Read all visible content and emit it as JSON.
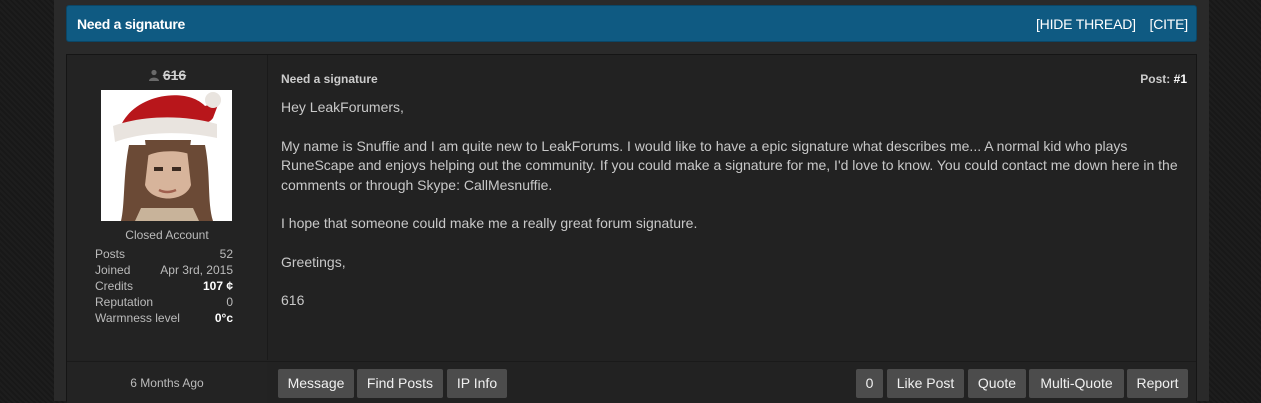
{
  "thread": {
    "title": "Need a signature",
    "hide_label": "[HIDE THREAD]",
    "cite_label": "[CITE]"
  },
  "user": {
    "name": "616",
    "rank": "Closed Account",
    "stats": [
      {
        "label": "Posts",
        "value": "52"
      },
      {
        "label": "Joined",
        "value": "Apr 3rd, 2015"
      },
      {
        "label": "Credits",
        "value": "107 ¢"
      },
      {
        "label": "Reputation",
        "value": "0"
      },
      {
        "label": "Warmness level",
        "value": "0°c"
      }
    ]
  },
  "post": {
    "subject": "Need a signature",
    "number_label": "Post:",
    "number": "#1",
    "date": "6 Months Ago",
    "paragraphs": [
      "Hey LeakForumers,",
      "My name is Snuffie and I am quite new to LeakForums. I would like to have a epic signature what describes me... A normal kid who plays RuneScape and enjoys helping out the community. If you could make a signature for me, I'd love to know. You could contact me down here in the comments or through Skype: CallMesnuffie.",
      "I hope that someone could make me a really great forum signature.",
      "Greetings,",
      "616"
    ]
  },
  "buttons": {
    "message": "Message",
    "find_posts": "Find Posts",
    "ip_info": "IP Info",
    "like_count": "0",
    "like_post": "Like Post",
    "quote": "Quote",
    "multi_quote": "Multi-Quote",
    "report": "Report"
  }
}
